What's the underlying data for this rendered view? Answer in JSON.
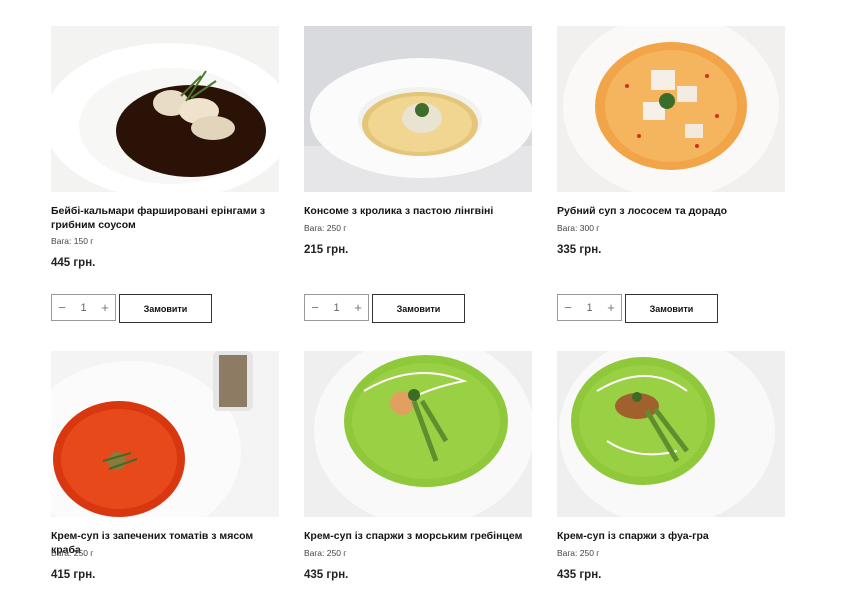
{
  "products": [
    {
      "name": "Бейбі-кальмари фаршировані ерінгами з грибним соусом",
      "weight": "Вага: 150 г",
      "price": "445 грн.",
      "qty": "1",
      "order_label": "Замовити",
      "image": "squid-dish"
    },
    {
      "name": "Консоме з кролика з пастою лінгвіні",
      "weight": "Вага: 250 г",
      "price": "215 грн.",
      "qty": "1",
      "order_label": "Замовити",
      "image": "consomme-dish"
    },
    {
      "name": "Рубний суп з лососем та дорадо",
      "weight": "Вага: 300 г",
      "price": "335 грн.",
      "qty": "1",
      "order_label": "Замовити",
      "image": "fish-soup-dish"
    },
    {
      "name": "Крем-суп із запечених томатів з мясом краба",
      "weight": "Вага: 250 г",
      "price": "415 грн.",
      "image": "tomato-soup-dish"
    },
    {
      "name": "Крем-суп із спаржи з морським гребінцем",
      "weight": "Вага: 250 г",
      "price": "435 грн.",
      "image": "asparagus-scallop-dish"
    },
    {
      "name": "Крем-суп із спаржи з фуа-гра",
      "weight": "Вага: 250 г",
      "price": "435 грн.",
      "image": "asparagus-foie-gras-dish"
    }
  ],
  "stepper_icons": {
    "minus": "minus-icon",
    "plus": "plus-icon"
  },
  "colors": {
    "button_border": "#333333",
    "stepper_border": "#9a9a9a",
    "text": "#141414"
  }
}
